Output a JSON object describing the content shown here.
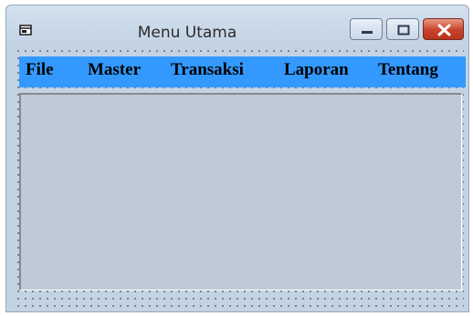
{
  "window": {
    "title": "Menu Utama",
    "app_icon": "form-icon",
    "controls": {
      "minimize_icon": "minimize-icon",
      "maximize_icon": "maximize-icon",
      "close_icon": "close-icon",
      "close_color": "#c8412b"
    }
  },
  "menubar": {
    "background": "#3399ff",
    "items": [
      {
        "label": "File"
      },
      {
        "label": "Master"
      },
      {
        "label": "Transaksi"
      },
      {
        "label": "Laporan"
      },
      {
        "label": "Tentang"
      }
    ]
  },
  "client_area": {
    "background": "#becbd7"
  }
}
